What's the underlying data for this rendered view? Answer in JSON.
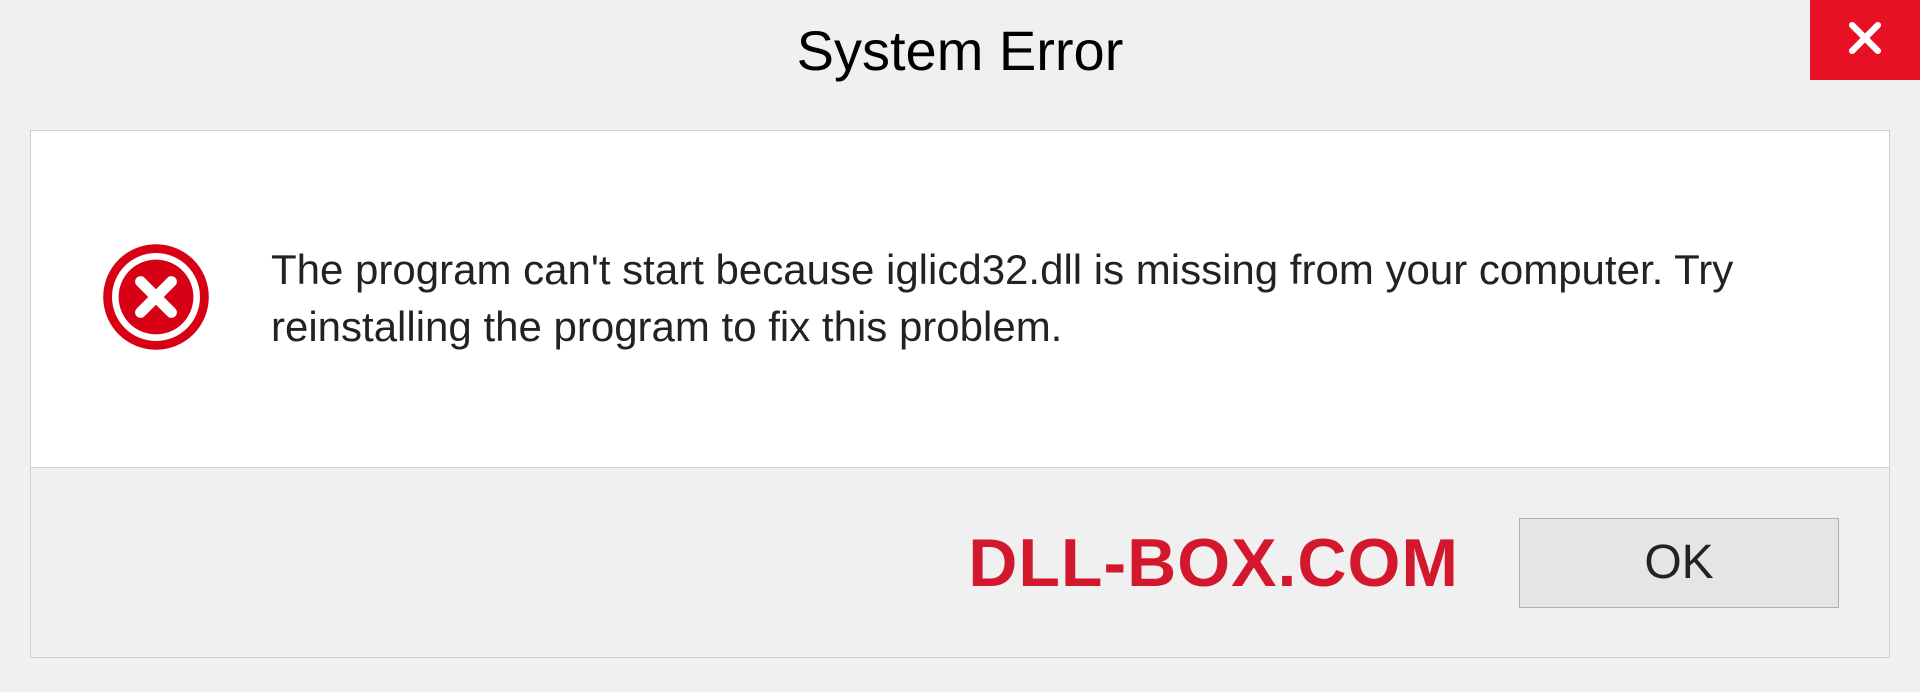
{
  "dialog": {
    "title": "System Error",
    "message": "The program can't start because iglicd32.dll is missing from your computer. Try reinstalling the program to fix this problem.",
    "ok_label": "OK"
  },
  "watermark": {
    "text": "DLL-BOX.COM"
  },
  "colors": {
    "close_bg": "#e81123",
    "error_icon": "#d70014",
    "watermark": "#d3172c"
  }
}
